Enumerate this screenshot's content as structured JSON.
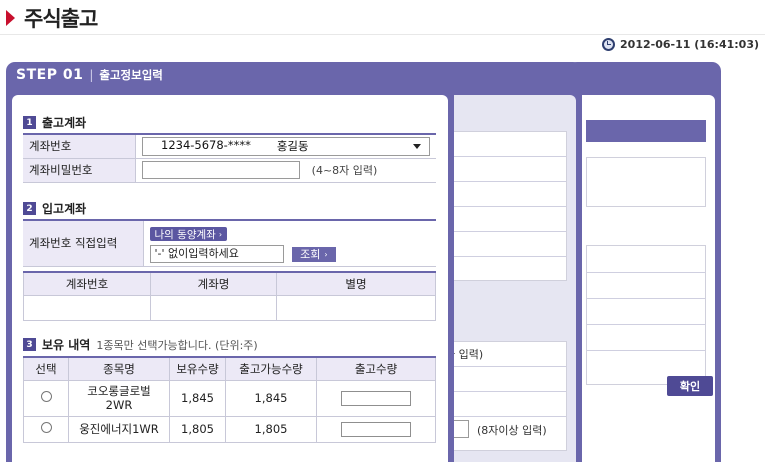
{
  "header": {
    "title": "주식출고",
    "datetime": "2012-06-11 (16:41:03)"
  },
  "step1": {
    "step_num": "STEP 01",
    "step_sep": "|",
    "step_title": "출고정보입력"
  },
  "section1": {
    "num": "1",
    "title": "출고계좌",
    "account_label": "계좌번호",
    "account_number": "1234-5678-****",
    "account_owner": "홍길동",
    "password_label": "계좌비밀번호",
    "password_hint": "(4~8자 입력)"
  },
  "section2": {
    "num": "2",
    "title": "입고계좌",
    "direct_label": "계좌번호 직접입력",
    "my_account_btn": "나의 동양계좌",
    "input_placeholder": "'-' 없이입력하세요",
    "lookup_btn": "조회",
    "columns": [
      "계좌번호",
      "계좌명",
      "별명"
    ]
  },
  "section3": {
    "num": "3",
    "title": "보유 내역",
    "note": "1종목만 선택가능합니다. (단위:주)",
    "columns": [
      "선택",
      "종목명",
      "보유수량",
      "출고가능수량",
      "출고수량"
    ],
    "rows": [
      {
        "name": "코오롱글로벌2WR",
        "holding": "1,845",
        "available": "1,845"
      },
      {
        "name": "웅진에너지1WR",
        "holding": "1,805",
        "available": "1,805"
      }
    ]
  },
  "background": {
    "text_a": "자 입력)",
    "text_b": "(8자이상 입력)",
    "confirm_btn": "확인"
  },
  "colors": {
    "panel": "#6a66ab",
    "accent_red": "#c8102e",
    "header_cell": "#ece9f6"
  }
}
